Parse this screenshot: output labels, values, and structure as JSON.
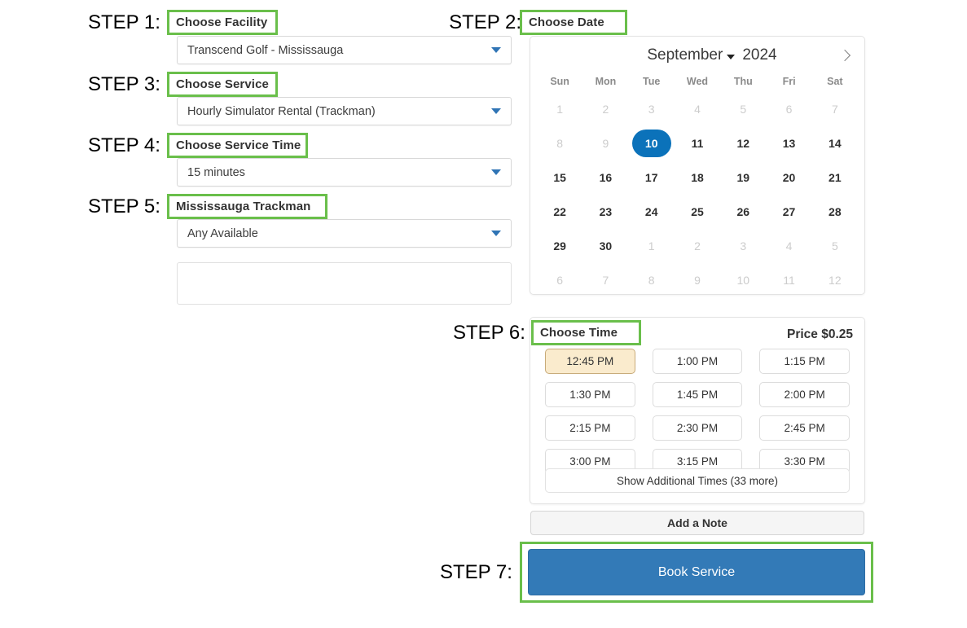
{
  "steps": {
    "s1": "STEP 1:",
    "s2": "STEP 2:",
    "s3": "STEP 3:",
    "s4": "STEP 4:",
    "s5": "STEP 5:",
    "s6": "STEP 6:",
    "s7": "STEP 7:"
  },
  "fields": {
    "facility": {
      "label": "Choose Facility",
      "value": "Transcend Golf - Mississauga"
    },
    "service": {
      "label": "Choose Service",
      "value": "Hourly Simulator Rental (Trackman)"
    },
    "service_time": {
      "label": "Choose Service Time",
      "value": "15 minutes"
    },
    "resource": {
      "label": "Mississauga Trackman",
      "value": "Any Available"
    }
  },
  "calendar": {
    "label": "Choose Date",
    "month": "September",
    "year": "2024",
    "next_icon": "chevron-right-icon",
    "month_caret_icon": "chevron-down-icon",
    "weekdays": [
      "Sun",
      "Mon",
      "Tue",
      "Wed",
      "Thu",
      "Fri",
      "Sat"
    ],
    "weeks": [
      [
        {
          "d": "1",
          "state": "muted"
        },
        {
          "d": "2",
          "state": "muted"
        },
        {
          "d": "3",
          "state": "muted"
        },
        {
          "d": "4",
          "state": "muted"
        },
        {
          "d": "5",
          "state": "muted"
        },
        {
          "d": "6",
          "state": "muted"
        },
        {
          "d": "7",
          "state": "muted"
        }
      ],
      [
        {
          "d": "8",
          "state": "muted"
        },
        {
          "d": "9",
          "state": "muted"
        },
        {
          "d": "10",
          "state": "selected"
        },
        {
          "d": "11",
          "state": "normal"
        },
        {
          "d": "12",
          "state": "normal"
        },
        {
          "d": "13",
          "state": "normal"
        },
        {
          "d": "14",
          "state": "normal"
        }
      ],
      [
        {
          "d": "15",
          "state": "normal"
        },
        {
          "d": "16",
          "state": "normal"
        },
        {
          "d": "17",
          "state": "normal"
        },
        {
          "d": "18",
          "state": "normal"
        },
        {
          "d": "19",
          "state": "normal"
        },
        {
          "d": "20",
          "state": "normal"
        },
        {
          "d": "21",
          "state": "normal"
        }
      ],
      [
        {
          "d": "22",
          "state": "normal"
        },
        {
          "d": "23",
          "state": "normal"
        },
        {
          "d": "24",
          "state": "normal"
        },
        {
          "d": "25",
          "state": "normal"
        },
        {
          "d": "26",
          "state": "normal"
        },
        {
          "d": "27",
          "state": "normal"
        },
        {
          "d": "28",
          "state": "normal"
        }
      ],
      [
        {
          "d": "29",
          "state": "normal"
        },
        {
          "d": "30",
          "state": "normal"
        },
        {
          "d": "1",
          "state": "muted"
        },
        {
          "d": "2",
          "state": "muted"
        },
        {
          "d": "3",
          "state": "muted"
        },
        {
          "d": "4",
          "state": "muted"
        },
        {
          "d": "5",
          "state": "muted"
        }
      ],
      [
        {
          "d": "6",
          "state": "muted"
        },
        {
          "d": "7",
          "state": "muted"
        },
        {
          "d": "8",
          "state": "muted"
        },
        {
          "d": "9",
          "state": "muted"
        },
        {
          "d": "10",
          "state": "muted"
        },
        {
          "d": "11",
          "state": "muted"
        },
        {
          "d": "12",
          "state": "muted"
        }
      ]
    ]
  },
  "time_section": {
    "label": "Choose Time",
    "price": "Price $0.25",
    "slots": [
      {
        "t": "12:45 PM",
        "state": "selected"
      },
      {
        "t": "1:00 PM",
        "state": "normal"
      },
      {
        "t": "1:15 PM",
        "state": "normal"
      },
      {
        "t": "1:30 PM",
        "state": "normal"
      },
      {
        "t": "1:45 PM",
        "state": "normal"
      },
      {
        "t": "2:00 PM",
        "state": "normal"
      },
      {
        "t": "2:15 PM",
        "state": "normal"
      },
      {
        "t": "2:30 PM",
        "state": "normal"
      },
      {
        "t": "2:45 PM",
        "state": "normal"
      },
      {
        "t": "3:00 PM",
        "state": "normal"
      },
      {
        "t": "3:15 PM",
        "state": "normal"
      },
      {
        "t": "3:30 PM",
        "state": "normal"
      }
    ],
    "show_more": "Show Additional Times (33 more)"
  },
  "actions": {
    "add_note": "Add a Note",
    "book_service": "Book Service"
  },
  "colors": {
    "highlight_green": "#6abf4b",
    "selected_date_blue": "#0b72ba",
    "selected_slot_cream": "#faebcd",
    "book_button_blue": "#337ab7",
    "caret_blue": "#2f74b5"
  }
}
